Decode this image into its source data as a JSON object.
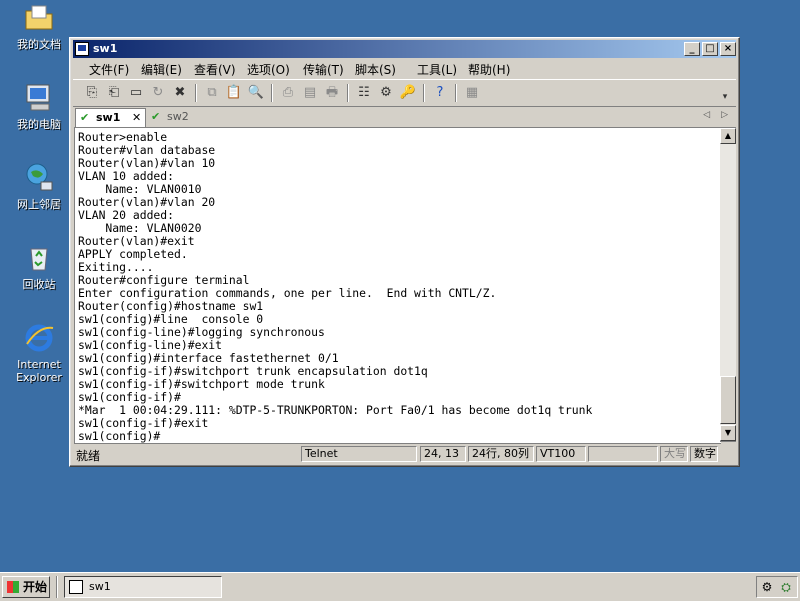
{
  "desktop": {
    "icons": [
      {
        "label": "我的文档",
        "icon": "folder-documents-icon"
      },
      {
        "label": "我的电脑",
        "icon": "my-computer-icon"
      },
      {
        "label": "网上邻居",
        "icon": "network-places-icon"
      },
      {
        "label": "回收站",
        "icon": "recycle-bin-icon"
      },
      {
        "label": "Internet Explorer",
        "icon": "internet-explorer-icon"
      }
    ]
  },
  "window": {
    "title": "sw1",
    "menu": [
      "文件(F)",
      "编辑(E)",
      "查看(V)",
      "选项(O)",
      "传输(T)",
      "脚本(S)",
      "工具(L)",
      "帮助(H)"
    ],
    "tabs": [
      {
        "label": "sw1",
        "active": true
      },
      {
        "label": "sw2",
        "active": false
      }
    ],
    "terminal_lines": [
      "Router>enable",
      "Router#vlan database",
      "Router(vlan)#vlan 10",
      "VLAN 10 added:",
      "    Name: VLAN0010",
      "Router(vlan)#vlan 20",
      "VLAN 20 added:",
      "    Name: VLAN0020",
      "Router(vlan)#exit",
      "APPLY completed.",
      "Exiting....",
      "Router#configure terminal",
      "Enter configuration commands, one per line.  End with CNTL/Z.",
      "Router(config)#hostname sw1",
      "sw1(config)#line  console 0",
      "sw1(config-line)#logging synchronous",
      "sw1(config-line)#exit",
      "sw1(config)#interface fastethernet 0/1",
      "sw1(config-if)#switchport trunk encapsulation dot1q",
      "sw1(config-if)#switchport mode trunk",
      "sw1(config-if)#",
      "*Mar  1 00:04:29.111: %DTP-5-TRUNKPORTON: Port Fa0/1 has become dot1q trunk",
      "sw1(config-if)#exit",
      "sw1(config)#"
    ],
    "status": {
      "ready": "就绪",
      "protocol": "Telnet",
      "cursor": "24, 13",
      "size": "24行, 80列",
      "emulation": "VT100",
      "caps": "大写",
      "num": "数字"
    }
  },
  "taskbar": {
    "start_label": "开始",
    "task_label": "sw1"
  },
  "colors": {
    "desktop": "#3a6ea5",
    "titlebar_start": "#0a246a",
    "titlebar_end": "#a6caf0"
  }
}
